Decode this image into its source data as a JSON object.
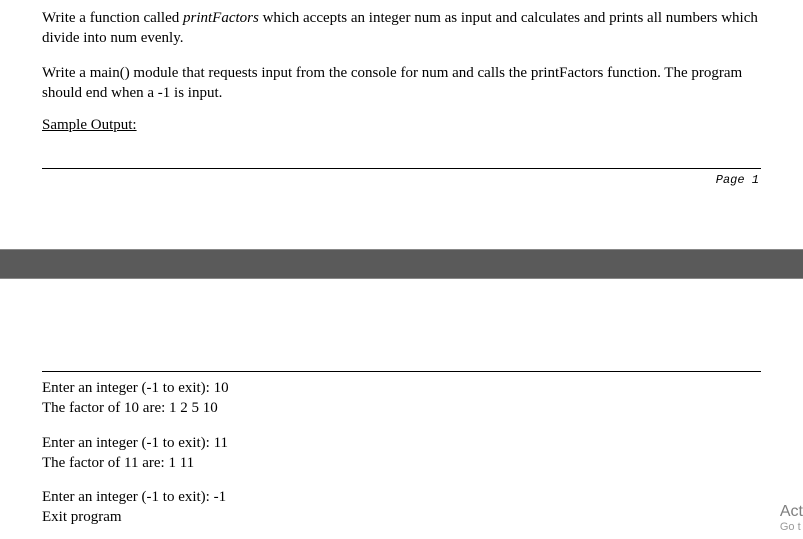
{
  "page1": {
    "para1_pre": "Write a function called ",
    "para1_fn": "printFactors",
    "para1_post": " which accepts an integer num as input and calculates and prints all numbers which divide into num evenly.",
    "para2": "Write a main() module that requests input from the console for num and calls the printFactors function.  The program should end when a -1 is input.",
    "sample_output_label": "Sample Output:",
    "page_label": "Page 1"
  },
  "output": {
    "block1_line1": "Enter an integer (-1 to exit): 10",
    "block1_line2": "The factor of 10 are: 1 2 5 10",
    "block2_line1": "Enter an integer (-1 to exit): 11",
    "block2_line2": "The factor of 11 are: 1 11",
    "block3_line1": "Enter an integer (-1 to exit): -1",
    "block3_line2": "Exit program"
  },
  "watermark": {
    "title": "Act",
    "sub": "Go t"
  }
}
